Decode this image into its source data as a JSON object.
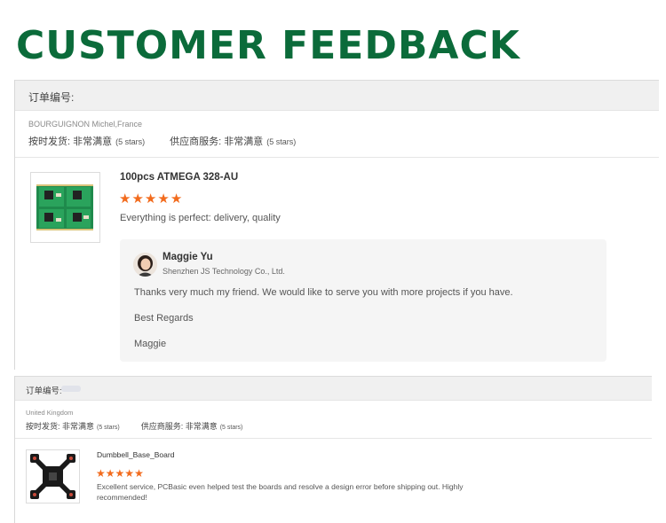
{
  "page": {
    "title": "CUSTOMER FEEDBACK"
  },
  "colors": {
    "title_green": "#0b6b3a",
    "star_orange": "#f26b1d",
    "header_gray": "#f0f0f0"
  },
  "reviews": [
    {
      "order_label": "订单编号:",
      "buyer": "BOURGUIGNON Michel,France",
      "ratings": [
        {
          "label": "按时发货: 非常满意",
          "note": "(5 stars)"
        },
        {
          "label": "供应商服务: 非常满意",
          "note": "(5 stars)"
        }
      ],
      "product": {
        "title": "100pcs ATMEGA 328-AU",
        "stars": 5,
        "comment": "Everything is perfect: delivery, quality",
        "image_icon": "green-pcb-board-image"
      },
      "reply": {
        "name": "Maggie Yu",
        "company": "Shenzhen JS Technology Co., Ltd.",
        "avatar_icon": "person-avatar",
        "lines": [
          "Thanks very much my friend. We would like to serve you with more projects if you have.",
          "Best Regards",
          "Maggie"
        ]
      }
    },
    {
      "order_label": "订单编号:",
      "buyer": "United Kingdom",
      "ratings": [
        {
          "label": "按时发货: 非常满意",
          "note": "(5 stars)"
        },
        {
          "label": "供应商服务: 非常满意",
          "note": "(5 stars)"
        }
      ],
      "product": {
        "title": "Dumbbell_Base_Board",
        "stars": 5,
        "comment": "Excellent service, PCBasic even helped test the boards and resolve a design error before shipping out. Highly recommended!",
        "image_icon": "black-quad-pcb-board-image"
      }
    }
  ]
}
